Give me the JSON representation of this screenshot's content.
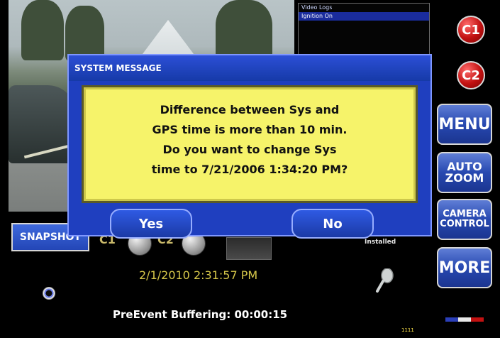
{
  "log_panel": {
    "entries": [
      "Video Logs",
      "Ignition On"
    ],
    "selected_index": 1
  },
  "right_panel": {
    "c1": "C1",
    "c2": "C2",
    "menu": "MENU",
    "auto_zoom": "AUTO\nZOOM",
    "camera_control": "CAMERA\nCONTROL",
    "more": "MORE"
  },
  "dialog": {
    "title": "SYSTEM MESSAGE",
    "message_lines": [
      "Difference between Sys and",
      "GPS time is more than 10 min.",
      "Do you want to change Sys",
      "time to 7/21/2006 1:34:20 PM?"
    ],
    "yes_label": "Yes",
    "no_label": "No"
  },
  "bottom": {
    "snapshot_label": "SNAPSHOT",
    "c1_label": "C1",
    "c2_label": "C2",
    "installed_text": "Installed",
    "datetime": "2/1/2010 2:31:57 PM",
    "buffering_text": "PreEvent Buffering: 00:00:15",
    "tiny_counter": "1111"
  },
  "colors": {
    "dialog_bg": "#1f3fbf",
    "message_bg": "#f6f36a",
    "button_blue": "#2748b0",
    "alert_red": "#c21111",
    "clock_yellow": "#d7c84a"
  },
  "icons": {
    "mic": "microphone-icon",
    "record": "record-indicator-icon",
    "signal": "status-flag-icon"
  }
}
